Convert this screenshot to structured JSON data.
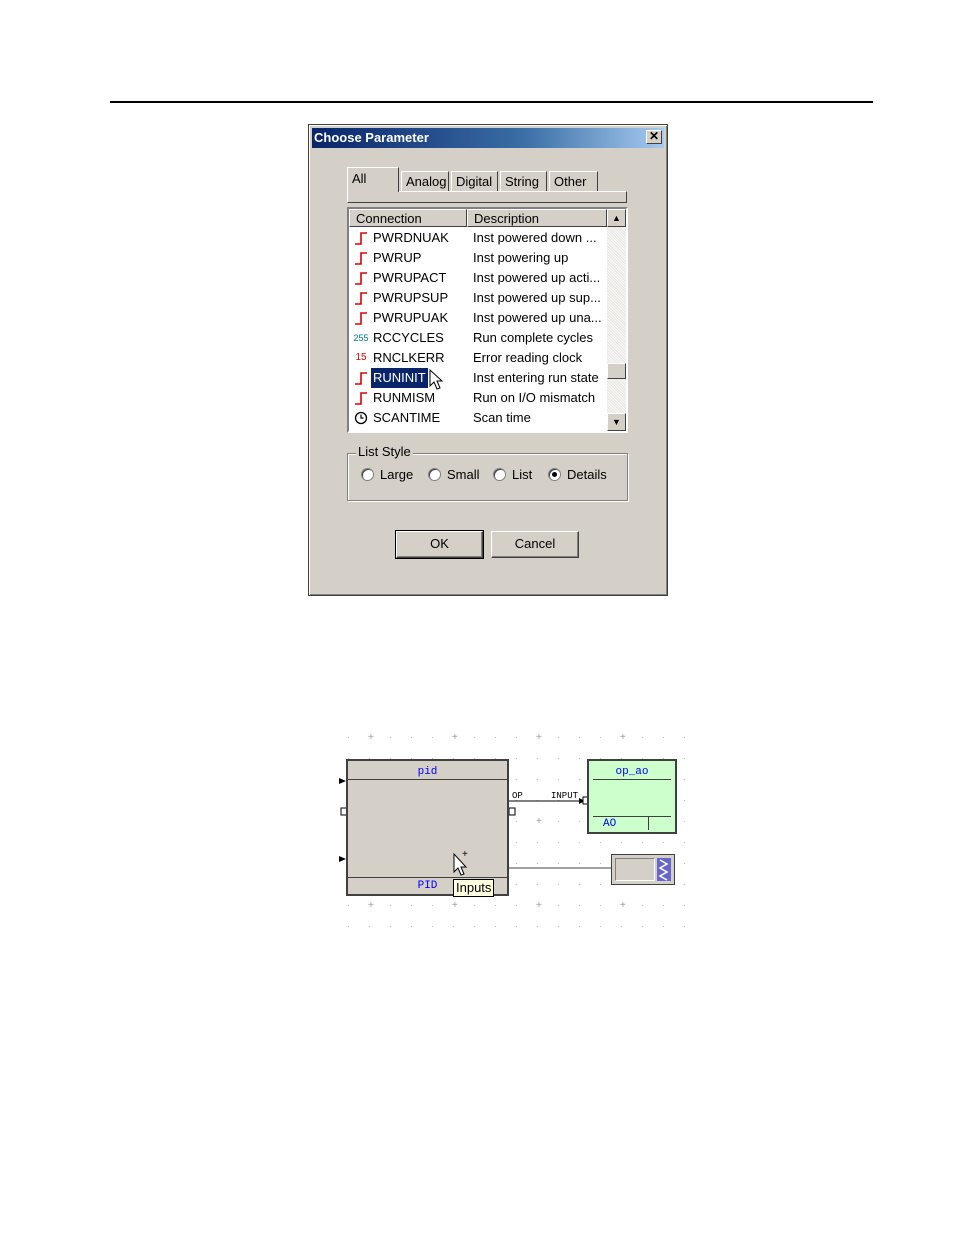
{
  "dialog": {
    "title": "Choose Parameter",
    "close_glyph": "✕",
    "tabs": [
      {
        "label": "All",
        "active": true
      },
      {
        "label": "Analog",
        "active": false
      },
      {
        "label": "Digital",
        "active": false
      },
      {
        "label": "String",
        "active": false
      },
      {
        "label": "Other",
        "active": false
      }
    ],
    "list": {
      "columns": [
        "Connection",
        "Description"
      ],
      "rows": [
        {
          "icon": "digital-step-icon",
          "connection": "PWRDNUAK",
          "description": "Inst powered down ..."
        },
        {
          "icon": "digital-step-icon",
          "connection": "PWRUP",
          "description": "Inst powering up"
        },
        {
          "icon": "digital-step-icon",
          "connection": "PWRUPACT",
          "description": "Inst powered up acti..."
        },
        {
          "icon": "digital-step-icon",
          "connection": "PWRUPSUP",
          "description": "Inst powered up sup..."
        },
        {
          "icon": "digital-step-icon",
          "connection": "PWRUPUAK",
          "description": "Inst powered up una..."
        },
        {
          "icon": "integer-255-icon",
          "icon_text": "255",
          "connection": "RCCYCLES",
          "description": "Run complete cycles"
        },
        {
          "icon": "integer-15-icon",
          "icon_text": "15",
          "connection": "RNCLKERR",
          "description": "Error reading clock"
        },
        {
          "icon": "digital-step-icon",
          "connection": "RUNINIT",
          "description": "Inst entering run state",
          "selected": true
        },
        {
          "icon": "digital-step-icon",
          "connection": "RUNMISM",
          "description": "Run on I/O mismatch"
        },
        {
          "icon": "clock-icon",
          "connection": "SCANTIME",
          "description": "Scan time"
        }
      ],
      "scroll_up_glyph": "▲",
      "scroll_down_glyph": "▼"
    },
    "list_style": {
      "label": "List Style",
      "options": [
        {
          "label": "Large",
          "checked": false
        },
        {
          "label": "Small",
          "checked": false
        },
        {
          "label": "List",
          "checked": false
        },
        {
          "label": "Details",
          "checked": true
        }
      ]
    },
    "ok_label": "OK",
    "cancel_label": "Cancel",
    "colors": {
      "title_bar": "#0a246a",
      "face": "#d4d0c8",
      "selection": "#0a246a",
      "digital_icon": "#e00000",
      "integer_icon": "#008080"
    }
  },
  "diagram": {
    "pid_block": {
      "name": "pid",
      "type": "PID",
      "output_port": "OP"
    },
    "ao_block": {
      "name": "op_ao",
      "type": "AO",
      "input_port": "INPUT"
    },
    "tooltip": "Inputs",
    "colors": {
      "block_face": "#d4d0c8",
      "ao_face": "#ccffcc",
      "label": "#0000ff"
    }
  }
}
